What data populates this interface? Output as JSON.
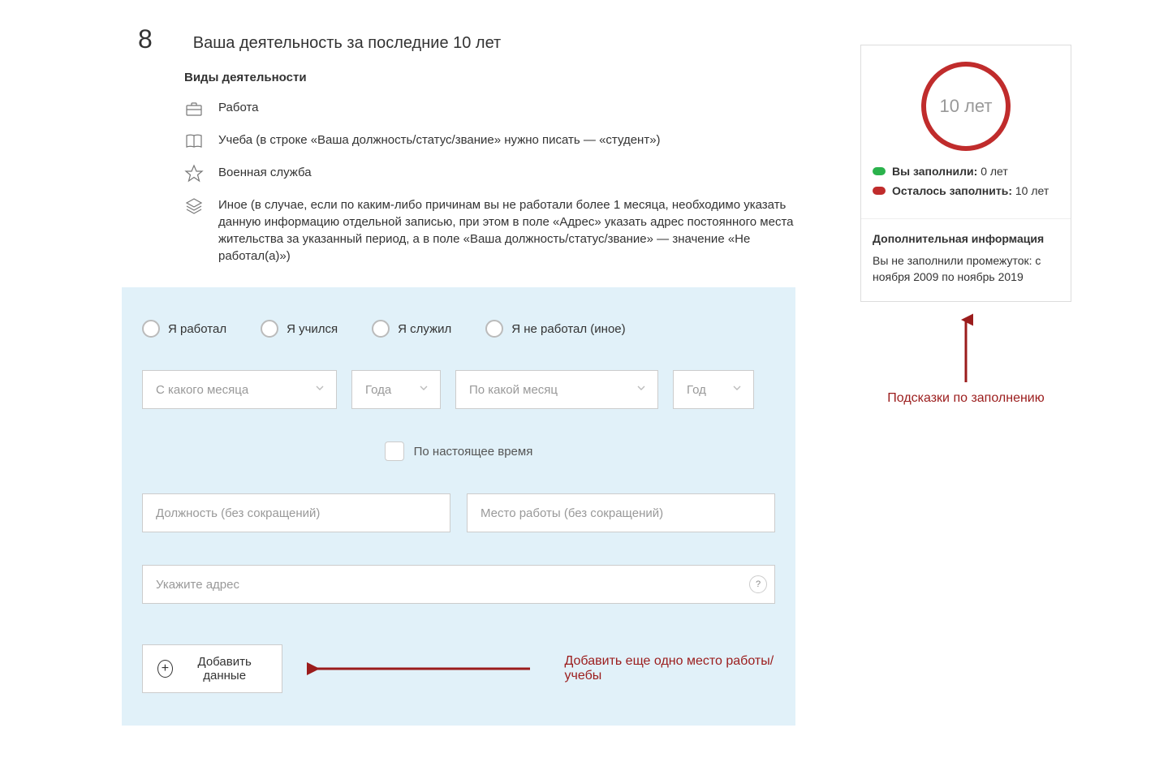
{
  "section": {
    "number": "8",
    "title": "Ваша деятельность за последние 10 лет",
    "subheading": "Виды деятельности"
  },
  "types": {
    "work": "Работа",
    "study": "Учеба (в строке «Ваша должность/статус/звание» нужно писать — «студент»)",
    "military": "Военная служба",
    "other": "Иное (в случае, если по каким-либо причинам вы не работали более 1 месяца, необходимо указать данную информацию отдельной записью, при этом в поле «Адрес» указать адрес постоянного места жительства за указанный период, а в поле «Ваша должность/статус/звание» — значение «Не работал(а)»)"
  },
  "radios": {
    "worked": "Я работал",
    "studied": "Я учился",
    "served": "Я служил",
    "none": "Я не работал (иное)"
  },
  "selects": {
    "from_month": "С какого месяца",
    "from_year": "Года",
    "to_month": "По какой месяц",
    "to_year": "Год"
  },
  "present": "По настоящее время",
  "inputs": {
    "position": "Должность (без сокращений)",
    "workplace": "Место работы (без сокращений)",
    "address": "Укажите адрес",
    "help": "?"
  },
  "add_button": "Добавить данные",
  "annotations": {
    "add_workplace": "Добавить еще одно место работы/учебы",
    "hints": "Подсказки по заполнению"
  },
  "sidebar": {
    "circle_text": "10 лет",
    "filled_label": "Вы заполнили:",
    "filled_value": "0 лет",
    "remain_label": "Осталось заполнить:",
    "remain_value": "10 лет",
    "extra_title": "Дополнительная информация",
    "extra_text": "Вы не заполнили промежуток: с ноября 2009 по ноябрь 2019"
  }
}
